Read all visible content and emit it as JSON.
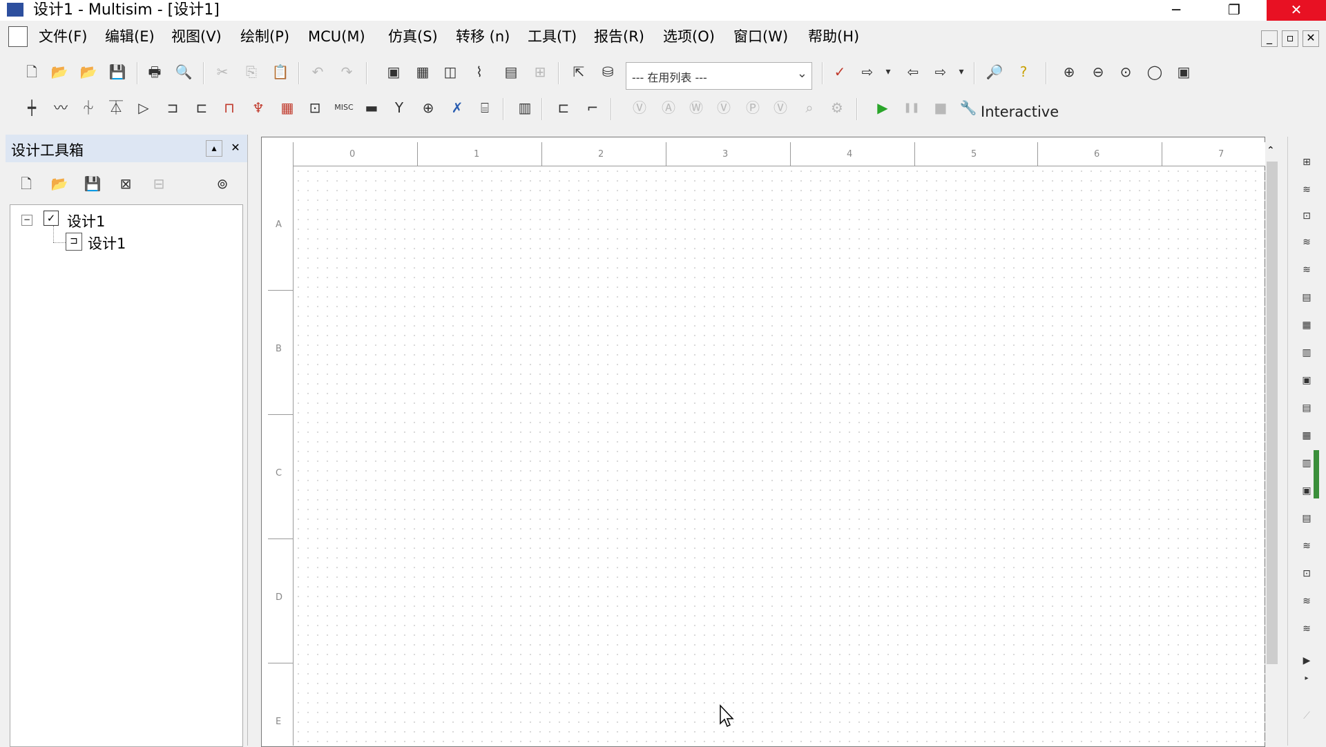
{
  "window": {
    "title": "设计1 - Multisim - [设计1]",
    "app_icon": "multisim-icon",
    "minimize": "─",
    "restore": "❐",
    "close": "✕"
  },
  "menu": {
    "items": [
      "文件(F)",
      "编辑(E)",
      "视图(V)",
      "绘制(P)",
      "MCU(M)",
      "仿真(S)",
      "转移 (n)",
      "工具(T)",
      "报告(R)",
      "选项(O)",
      "窗口(W)",
      "帮助(H)"
    ],
    "mdi_min": "_",
    "mdi_restore": "▫",
    "mdi_close": "✕"
  },
  "toolbar": {
    "in_use_list": "--- 在用列表 ---",
    "interactive_label": "Interactive",
    "run_icon": "▶",
    "pause_icon": "❚❚",
    "stop_icon": "■"
  },
  "panel": {
    "title": "设计工具箱",
    "pin": "▴",
    "close": "✕",
    "tree": [
      {
        "label": "设计1",
        "level": 0
      },
      {
        "label": "设计1",
        "level": 1
      }
    ]
  },
  "canvas": {
    "col_labels": [
      "0",
      "1",
      "2",
      "3",
      "4",
      "5",
      "6",
      "7"
    ],
    "row_labels": [
      "A",
      "B",
      "C",
      "D",
      "E"
    ]
  },
  "colors": {
    "close_red": "#e81123",
    "run_green": "#2aa52a",
    "panel_header": "#dde6f3"
  }
}
